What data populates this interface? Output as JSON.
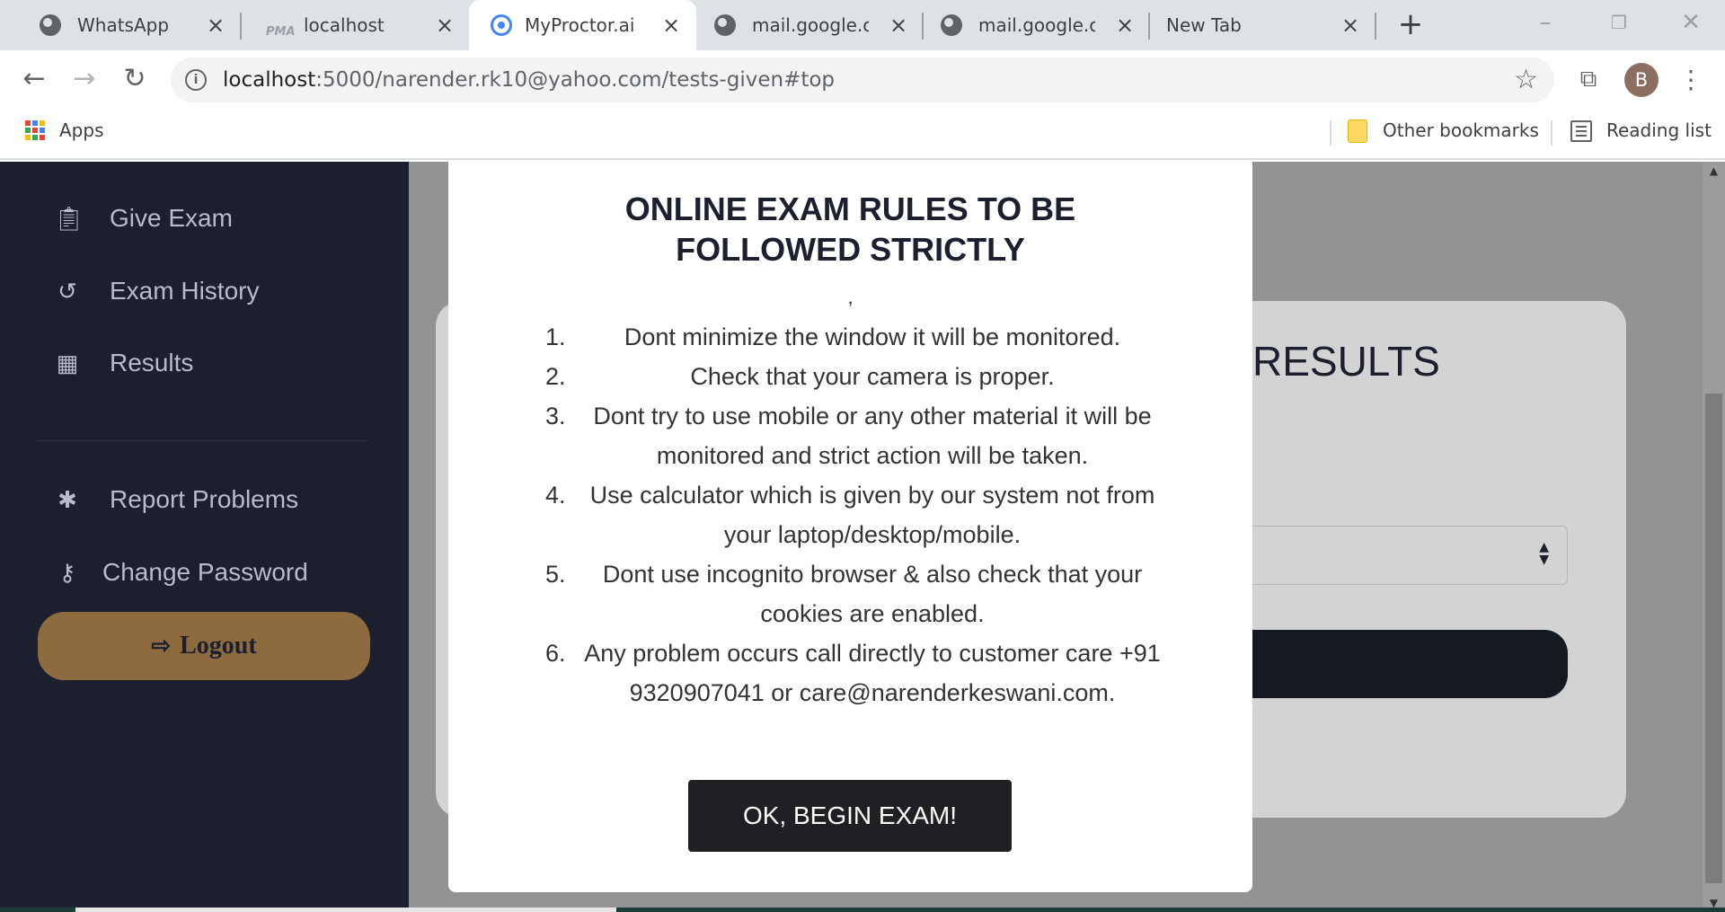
{
  "browser": {
    "tabs": [
      {
        "title": "WhatsApp",
        "icon": "globe-icon",
        "active": false
      },
      {
        "title": "localhost",
        "icon": "pma-icon",
        "active": false
      },
      {
        "title": "MyProctor.ai",
        "icon": "chrome-icon",
        "active": true
      },
      {
        "title": "mail.google.com",
        "icon": "globe-icon",
        "active": false
      },
      {
        "title": "mail.google.com",
        "icon": "globe-icon",
        "active": false
      },
      {
        "title": "New Tab",
        "icon": "",
        "active": false
      }
    ],
    "url_host": "localhost",
    "url_path": ":5000/narender.rk10@yahoo.com/tests-given#top",
    "profile_initial": "B",
    "bookmarks": {
      "apps_label": "Apps",
      "other_bookmarks_label": "Other bookmarks",
      "reading_list_label": "Reading list"
    }
  },
  "sidebar": {
    "items": [
      {
        "label": "Give Exam",
        "icon": "clipboard-icon"
      },
      {
        "label": "Exam History",
        "icon": "history-icon"
      },
      {
        "label": "Results",
        "icon": "chart-icon"
      },
      {
        "label": "Report Problems",
        "icon": "bug-icon"
      },
      {
        "label": "Change Password",
        "icon": "key-icon"
      }
    ],
    "logout_label": "Logout"
  },
  "card": {
    "heading_fragment": "R RESULTS"
  },
  "modal": {
    "title": "ONLINE EXAM RULES TO BE FOLLOWED STRICTLY",
    "stray_comma": ",",
    "rules": [
      {
        "num": "1.",
        "text": "Dont minimize the window it will be monitored."
      },
      {
        "num": "2.",
        "text": "Check that your camera is proper."
      },
      {
        "num": "3.",
        "text": "Dont try to use mobile or any other material it will be monitored and strict action will be taken."
      },
      {
        "num": "4.",
        "text": "Use calculator which is given by our system not from your laptop/desktop/mobile."
      },
      {
        "num": "5.",
        "text": "Dont use incognito browser & also check that your cookies are enabled."
      },
      {
        "num": "6.",
        "text": "Any problem occurs call directly to customer care +91 9320907041 or care@narenderkeswani.com."
      }
    ],
    "button_label": "OK, BEGIN EXAM!"
  },
  "colors": {
    "sidebar_bg": "#1b1f2e",
    "logout_bg": "#8e6a3f",
    "overlay_bg": "#939393",
    "button_dark": "#1e2024"
  }
}
